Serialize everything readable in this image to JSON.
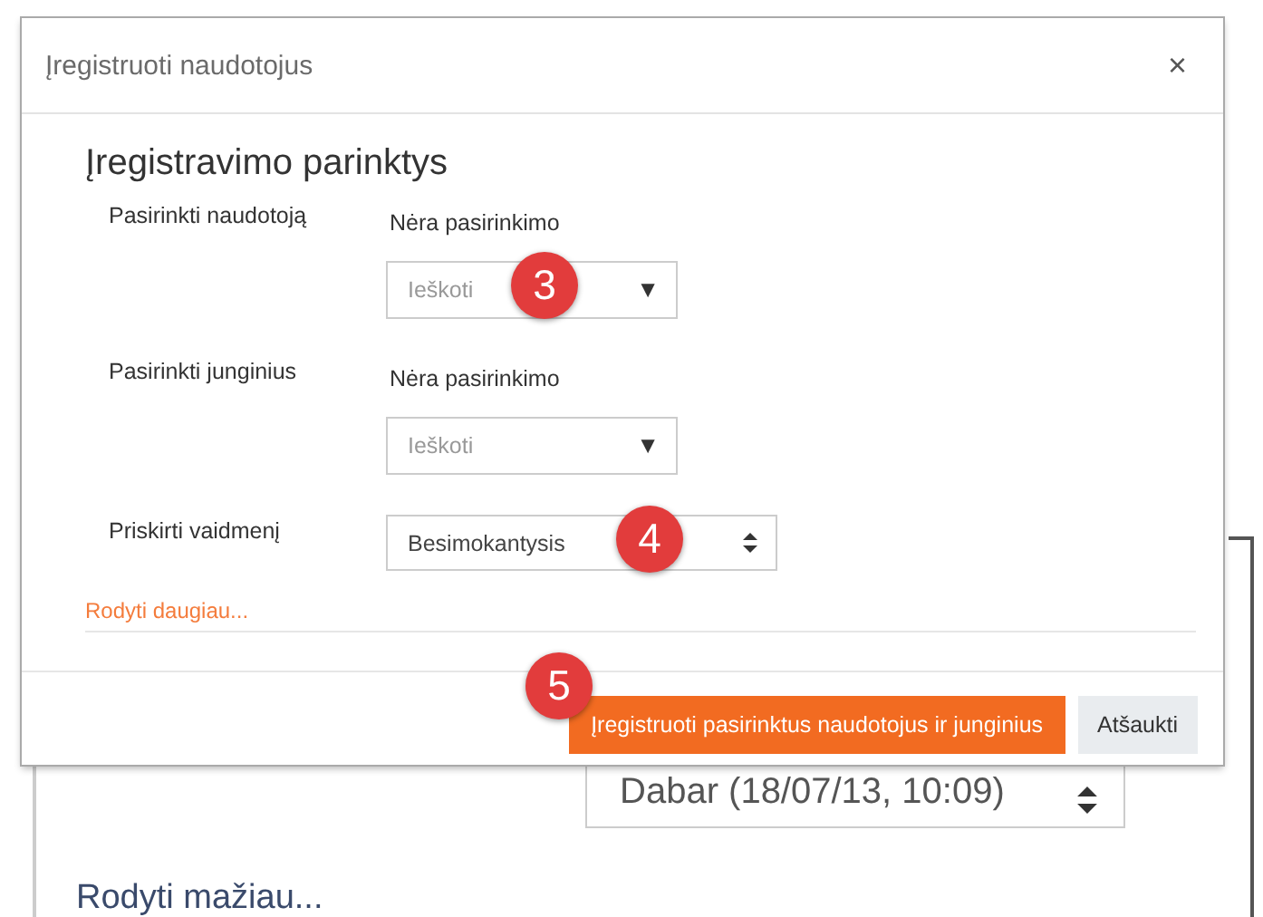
{
  "background": {
    "start_select": {
      "value": "Dabar (18/07/13, 10:09)"
    },
    "show_less_link": "Rodyti mažiau..."
  },
  "dialog": {
    "title": "Įregistruoti naudotojus",
    "close": "×",
    "heading": "Įregistravimo parinktys",
    "fields": [
      {
        "kind": "autocomplete",
        "label": "Pasirinkti naudotoją",
        "selection": "Nėra pasirinkimo",
        "placeholder": "Ieškoti",
        "arrow": "▼"
      },
      {
        "kind": "autocomplete",
        "label": "Pasirinkti junginius",
        "selection": "Nėra pasirinkimo",
        "placeholder": "Ieškoti",
        "arrow": "▼"
      },
      {
        "kind": "select",
        "label": "Priskirti vaidmenį",
        "value": "Besimokantysis"
      }
    ],
    "show_more_link": "Rodyti daugiau...",
    "buttons": [
      {
        "kind": "primary",
        "label": "Įregistruoti pasirinktus naudotojus ir junginius"
      },
      {
        "kind": "secondary",
        "label": "Atšaukti"
      }
    ]
  },
  "annotations": [
    {
      "label": "3"
    },
    {
      "label": "4"
    },
    {
      "label": "5"
    }
  ]
}
